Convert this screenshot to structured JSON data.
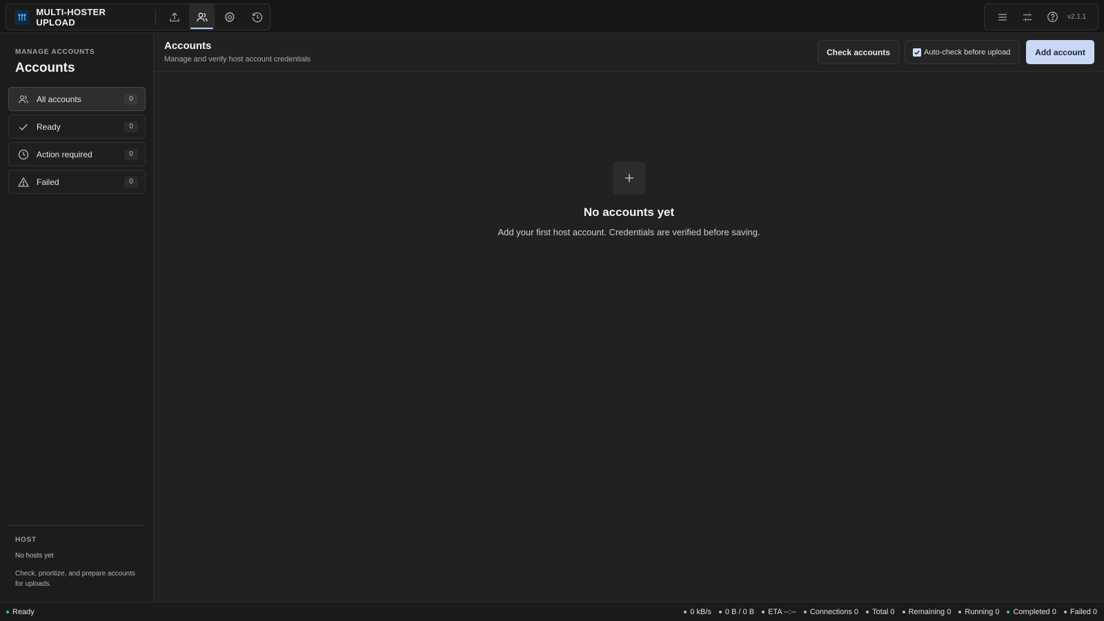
{
  "app": {
    "title": "MULTI-HOSTER UPLOAD",
    "version": "v2.1.1",
    "nav": [
      {
        "name": "upload",
        "icon": "upload-icon",
        "active": false
      },
      {
        "name": "accounts",
        "icon": "users-icon",
        "active": true
      },
      {
        "name": "settings",
        "icon": "gear-icon",
        "active": false
      },
      {
        "name": "history",
        "icon": "history-icon",
        "active": false
      }
    ],
    "right_icons": [
      "menu-icon",
      "sliders-icon",
      "help-icon"
    ]
  },
  "sidebar": {
    "eyebrow": "MANAGE ACCOUNTS",
    "title": "Accounts",
    "filters": [
      {
        "label": "All accounts",
        "count": "0",
        "icon": "users-icon",
        "active": true
      },
      {
        "label": "Ready",
        "count": "0",
        "icon": "check-icon",
        "active": false
      },
      {
        "label": "Action required",
        "count": "0",
        "icon": "clock-icon",
        "active": false
      },
      {
        "label": "Failed",
        "count": "0",
        "icon": "warning-icon",
        "active": false
      }
    ],
    "host": {
      "heading": "HOST",
      "empty": "No hosts yet",
      "description": "Check, prioritize, and prepare accounts for uploads."
    }
  },
  "main": {
    "title": "Accounts",
    "subtitle": "Manage and verify host account credentials",
    "check_button": "Check accounts",
    "auto_check_label": "Auto-check before upload",
    "auto_check_checked": true,
    "add_button": "Add account",
    "empty_state": {
      "icon": "plus-icon",
      "title": "No accounts yet",
      "text": "Add your first host account. Credentials are verified before saving."
    }
  },
  "status": {
    "state": "Ready",
    "speed": "0 kB/s",
    "transferred": "0 B / 0 B",
    "eta": "ETA --:--",
    "connections": "Connections 0",
    "total": "Total 0",
    "remaining": "Remaining 0",
    "running": "Running 0",
    "completed": "Completed 0",
    "failed": "Failed 0"
  },
  "colors": {
    "background": "#212121",
    "accent": "#c9d8f7",
    "status_ok": "#4ccf6b"
  }
}
